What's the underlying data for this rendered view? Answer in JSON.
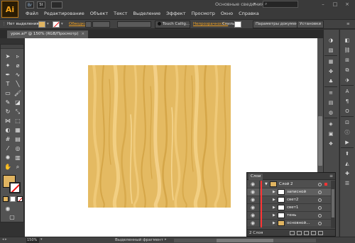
{
  "app": {
    "logo": "Ai",
    "bridge": "Br",
    "stock": "St",
    "workspace": "Основные сведения"
  },
  "menu": [
    "Файл",
    "Редактирование",
    "Объект",
    "Текст",
    "Выделение",
    "Эффект",
    "Просмотр",
    "Окно",
    "Справка"
  ],
  "control": {
    "selection_label": "Нет выделения",
    "stroke_label": "Обводка:",
    "brush_name": "Touch Callig...",
    "opacity_label": "Непрозрачность:",
    "style_label": "Стиль:",
    "doc_setup": "Параметры документа",
    "preferences": "Установки"
  },
  "document": {
    "tab_title": "урок.ai* @ 150% (RGB/Просмотр)",
    "close": "×"
  },
  "status": {
    "zoom": "150%",
    "selection_tool": "Выделенный фрагмент"
  },
  "layers": {
    "tab": "Слои",
    "count": "2 Слоя",
    "rows": [
      {
        "name": "Слой 2",
        "type": "layer"
      },
      {
        "name": "записной",
        "type": "sublayer"
      },
      {
        "name": "свет2",
        "type": "sublayer"
      },
      {
        "name": "свет1",
        "type": "sublayer"
      },
      {
        "name": "тень",
        "type": "sublayer"
      },
      {
        "name": "основной...",
        "type": "sublayer"
      }
    ]
  },
  "colors": {
    "accent": "#e0b461",
    "wood_light": "#efc978",
    "wood_base": "#e4ba62",
    "wood_dark": "#d5a648",
    "layer_color": "#ff3333"
  }
}
